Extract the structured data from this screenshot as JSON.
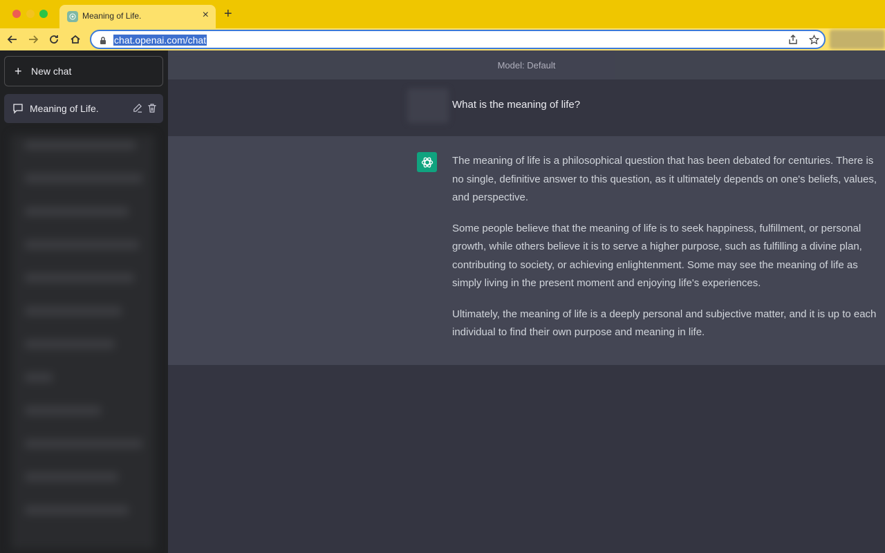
{
  "browser": {
    "tab": {
      "title": "Meaning of Life.",
      "favicon": "chatgpt-logo-icon",
      "close": "×"
    },
    "new_tab": "+",
    "url": "chat.openai.com/chat",
    "accent": "#efc600"
  },
  "sidebar": {
    "new_chat_label": "New chat",
    "new_chat_icon": "+",
    "chats": [
      {
        "label": "Meaning of Life."
      }
    ]
  },
  "main": {
    "model_label": "Model: Default",
    "user_message": "What is the meaning of life?",
    "assistant_paragraphs": [
      "The meaning of life is a philosophical question that has been debated for centuries. There is no single, definitive answer to this question, as it ultimately depends on one's beliefs, values, and perspective.",
      "Some people believe that the meaning of life is to seek happiness, fulfillment, or personal growth, while others believe it is to serve a higher purpose, such as fulfilling a divine plan, contributing to society, or achieving enlightenment. Some may see the meaning of life as simply living in the present moment and enjoying life's experiences.",
      "Ultimately, the meaning of life is a deeply personal and subjective matter, and it is up to each individual to find their own purpose and meaning in life."
    ],
    "assistant_color": "#10a37f"
  }
}
